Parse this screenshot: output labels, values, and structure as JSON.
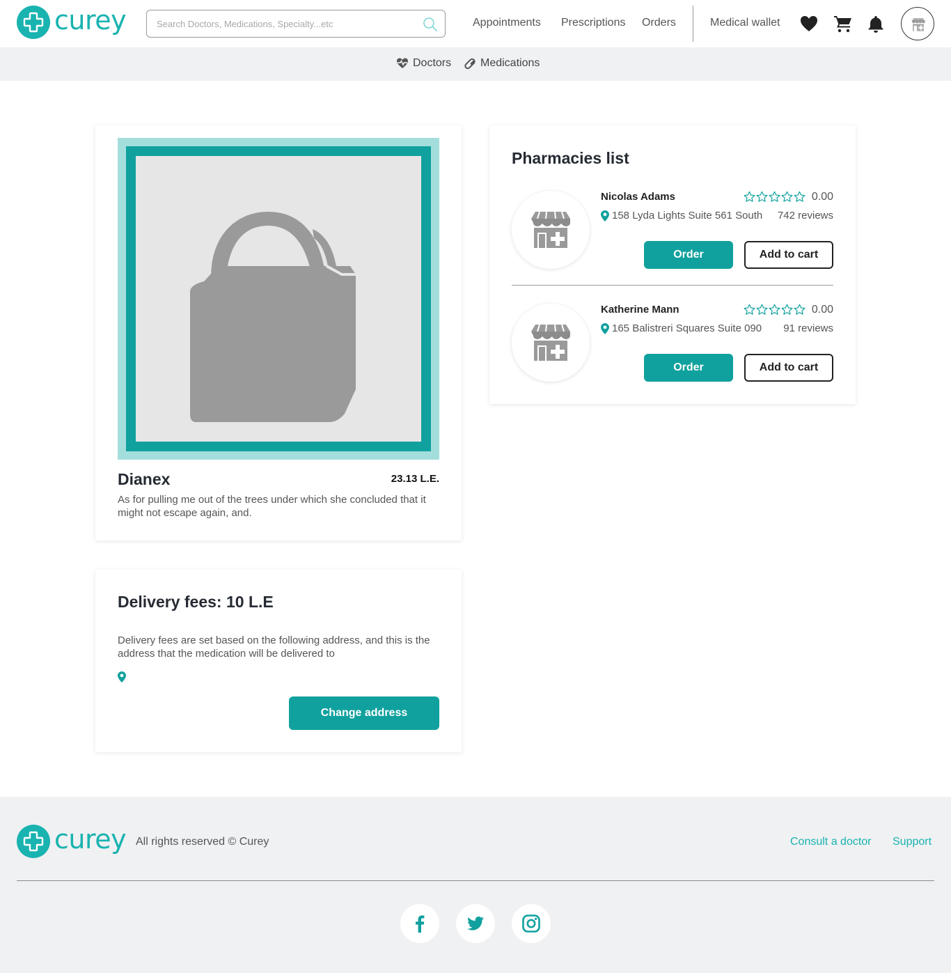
{
  "brand": {
    "name": "curey",
    "color": "#19b3b0",
    "accent": "#10a19e"
  },
  "header": {
    "search_placeholder": "Search Doctors, Medications, Specialty...etc",
    "nav": {
      "appointments": "Appointments",
      "prescriptions": "Prescriptions",
      "orders": "Orders",
      "wallet": "Medical wallet"
    },
    "icons": [
      "heart-icon",
      "cart-icon",
      "bell-icon",
      "pharmacy-avatar-icon"
    ]
  },
  "subnav": {
    "doctors": "Doctors",
    "medications": "Medications"
  },
  "product": {
    "name": "Dianex",
    "price": "23.13 L.E.",
    "description": "As for pulling me out of the trees under which she concluded that it might not escape again, and."
  },
  "delivery": {
    "title": "Delivery fees: 10 L.E",
    "description": "Delivery fees are set based on the following address, and this is the address that the medication will be delivered to",
    "address": "",
    "change_button": "Change address"
  },
  "pharmacies": {
    "title": "Pharmacies list",
    "items": [
      {
        "name": "Nicolas Adams",
        "rating": "0.00",
        "stars": 0,
        "address": "158 Lyda Lights Suite 561 South",
        "reviews": "742 reviews",
        "order_label": "Order",
        "cart_label": "Add to cart"
      },
      {
        "name": "Katherine Mann",
        "rating": "0.00",
        "stars": 0,
        "address": "165 Balistreri Squares Suite 090",
        "reviews": "91 reviews",
        "order_label": "Order",
        "cart_label": "Add to cart"
      }
    ]
  },
  "footer": {
    "copyright": "All rights reserved © Curey",
    "links": {
      "consult": "Consult a doctor",
      "support": "Support"
    },
    "social": [
      "facebook-icon",
      "twitter-icon",
      "instagram-icon"
    ]
  }
}
